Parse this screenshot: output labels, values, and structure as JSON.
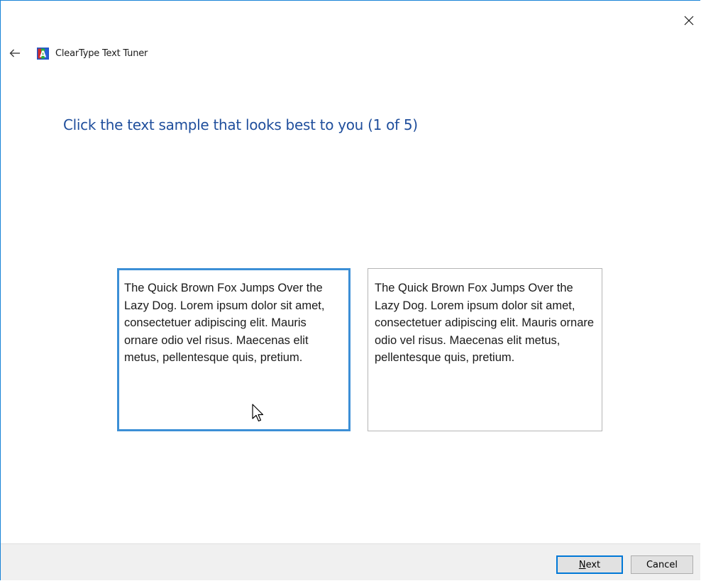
{
  "window": {
    "title": "ClearType Text Tuner",
    "app_icon": "cleartype-icon",
    "back_icon": "arrow-left-icon",
    "close_icon": "close-icon",
    "accent_color": "#1883d7"
  },
  "main": {
    "heading": "Click the text sample that looks best to you (1 of 5)",
    "heading_color": "#1f4e9c",
    "samples": [
      {
        "text": "The Quick Brown Fox Jumps Over the Lazy Dog. Lorem ipsum dolor sit amet, consectetuer adipiscing elit. Mauris ornare odio vel risus. Maecenas elit metus, pellentesque quis, pretium.",
        "selected": true
      },
      {
        "text": "The Quick Brown Fox Jumps Over the Lazy Dog. Lorem ipsum dolor sit amet, consectetuer adipiscing elit. Mauris ornare odio vel risus. Maecenas elit metus, pellentesque quis, pretium.",
        "selected": false
      }
    ]
  },
  "footer": {
    "next_mnemonic": "N",
    "next_rest": "ext",
    "cancel_label": "Cancel"
  }
}
